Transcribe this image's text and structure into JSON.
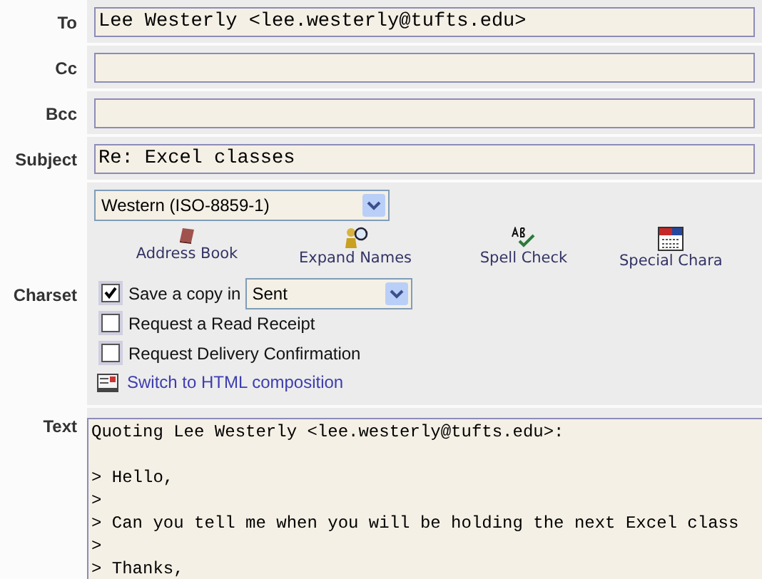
{
  "fields": [
    {
      "label": "To",
      "value": "Lee Westerly <lee.westerly@tufts.edu>"
    },
    {
      "label": "Cc"
    },
    {
      "label": "Bcc"
    },
    {
      "label": "Subject",
      "value": "Re: Excel classes"
    }
  ],
  "charset": {
    "label": "Charset",
    "value": "Western (ISO-8859-1)"
  },
  "toolbar": [
    {
      "kind": "book",
      "label": "Address Book"
    },
    {
      "kind": "expand",
      "label": "Expand Names"
    },
    {
      "kind": "spell",
      "label": "Spell Check"
    },
    {
      "kind": "special",
      "label": "Special Chara"
    }
  ],
  "options": [
    {
      "label": "Save a copy in",
      "checked": true,
      "folder": "Sent"
    },
    {
      "label": "Request a Read Receipt",
      "checked": false
    },
    {
      "label": "Request Delivery Confirmation",
      "checked": false
    }
  ],
  "html_link": "Switch to HTML composition",
  "text": {
    "label": "Text",
    "value": "Quoting Lee Westerly <lee.westerly@tufts.edu>:\n\n> Hello,\n>\n> Can you tell me when you will be holding the next Excel class\n>\n> Thanks,"
  }
}
